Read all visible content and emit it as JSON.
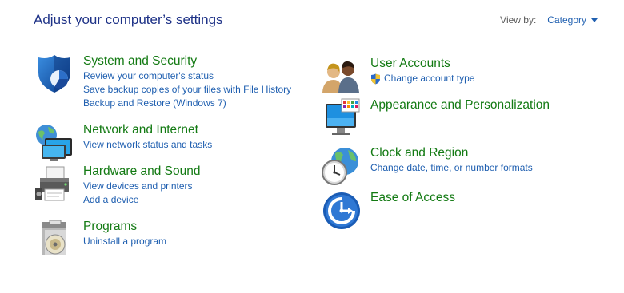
{
  "header": {
    "title": "Adjust your computer’s settings",
    "view_by_label": "View by:",
    "view_by_value": "Category"
  },
  "left": {
    "system": {
      "heading": "System and Security",
      "links": [
        "Review your computer's status",
        "Save backup copies of your files with File History",
        "Backup and Restore (Windows 7)"
      ],
      "icon": "shield-icon"
    },
    "network": {
      "heading": "Network and Internet",
      "links": [
        "View network status and tasks"
      ],
      "icon": "network-globe-icon"
    },
    "hardware": {
      "heading": "Hardware and Sound",
      "links": [
        "View devices and printers",
        "Add a device"
      ],
      "icon": "printer-icon"
    },
    "programs": {
      "heading": "Programs",
      "links": [
        "Uninstall a program"
      ],
      "icon": "programs-disc-icon"
    }
  },
  "right": {
    "users": {
      "heading": "User Accounts",
      "links": [
        "Change account type"
      ],
      "icon": "users-icon"
    },
    "appearance": {
      "heading": "Appearance and Personalization",
      "links": [],
      "icon": "monitor-palette-icon"
    },
    "clock": {
      "heading": "Clock and Region",
      "links": [
        "Change date, time, or number formats"
      ],
      "icon": "clock-globe-icon"
    },
    "ease": {
      "heading": "Ease of Access",
      "links": [],
      "icon": "ease-of-access-icon"
    }
  },
  "colors": {
    "heading_green": "#137a13",
    "link_blue": "#1f5fb0",
    "title_blue": "#1e3287"
  }
}
